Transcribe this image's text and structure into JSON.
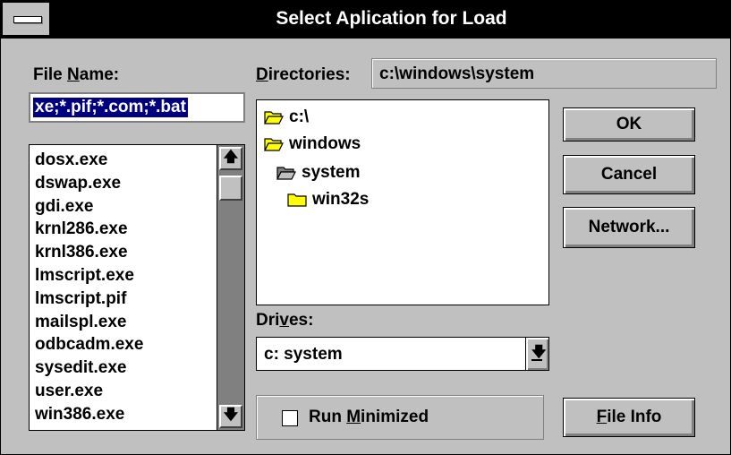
{
  "dialog": {
    "title": "Select Aplication for Load"
  },
  "file_name": {
    "label_pre": "File ",
    "label_accel": "N",
    "label_post": "ame:",
    "value": "xe;*.pif;*.com;*.bat"
  },
  "files": {
    "items": [
      "dosx.exe",
      "dswap.exe",
      "gdi.exe",
      "krnl286.exe",
      "krnl386.exe",
      "lmscript.exe",
      "lmscript.pif",
      "mailspl.exe",
      "odbcadm.exe",
      "sysedit.exe",
      "user.exe",
      "win386.exe"
    ]
  },
  "directories": {
    "label_accel": "D",
    "label_post": "irectories:",
    "path": "c:\\windows\\system",
    "items": [
      "c:\\",
      "windows",
      "system",
      "win32s"
    ]
  },
  "drives": {
    "label_pre": "Dri",
    "label_accel": "v",
    "label_post": "es:",
    "value": "c: system"
  },
  "buttons": {
    "ok": "OK",
    "cancel": "Cancel",
    "network": "Network...",
    "file_info_accel": "F",
    "file_info_post": "ile Info"
  },
  "run_minimized": {
    "label_pre": "Run ",
    "label_accel": "M",
    "label_post": "inimized",
    "checked": false
  },
  "icons": {
    "scroll_up": "up-arrow-icon",
    "scroll_down": "down-arrow-icon",
    "dropdown": "dropdown-arrow-icon",
    "folder_open": "open-folder-icon",
    "folder_closed": "closed-folder-icon"
  },
  "colors": {
    "face": "#c0c0c0",
    "titlebar": "#000000",
    "selection": "#000080",
    "folder": "#ffff00"
  }
}
